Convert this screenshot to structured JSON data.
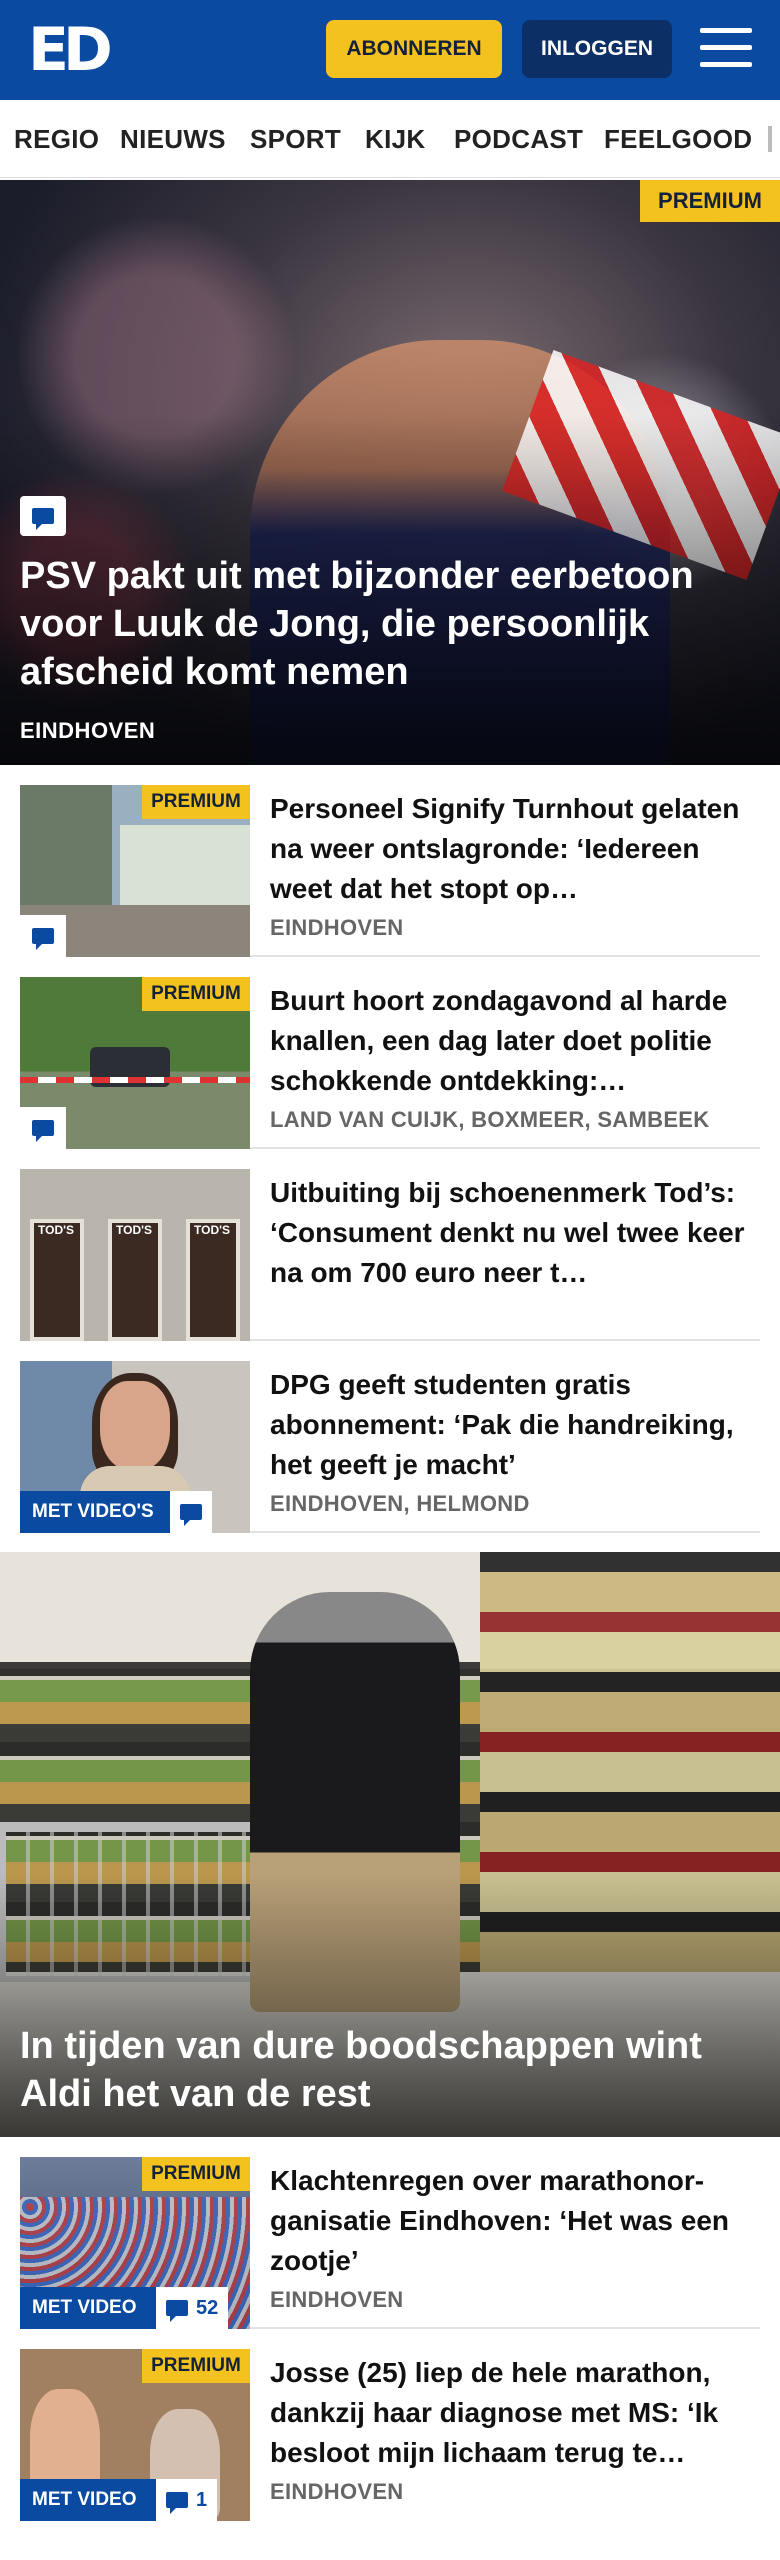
{
  "header": {
    "logo": "ED",
    "subscribe_label": "ABONNEREN",
    "login_label": "INLOGGEN",
    "menu_icon": "hamburger-menu-icon"
  },
  "nav": {
    "items": [
      "REGIO",
      "NIEUWS",
      "SPORT",
      "KIJK",
      "PODCAST",
      "FEELGOOD"
    ]
  },
  "hero": {
    "badge": "PREMIUM",
    "title": "PSV pakt uit met bijzonder eerbetoon voor Luuk de Jong, die persoonlijk afscheid komt nemen",
    "region": "EINDHOVEN",
    "comment_icon": "comment-icon"
  },
  "articles": [
    {
      "badge": "PREMIUM",
      "title": "Personeel Signify Turnhout gelaten na weer ontslagronde: ‘Iedereen weet dat het stopt op…",
      "region": "EINDHOVEN"
    },
    {
      "badge": "PREMIUM",
      "title": "Buurt hoort zondagavond al harde knallen, een dag later doet politie schokkende ontdekking:…",
      "region": "LAND VAN CUIJK, BOXMEER, SAMBEEK"
    },
    {
      "title": "Uitbuiting bij schoenenmerk Tod’s: ‘Consument denkt nu wel twee keer na om 700 euro neer t…",
      "thumb_signs": [
        "TOD'S",
        "TOD'S",
        "TOD'S"
      ]
    },
    {
      "video_label": "MET VIDEO'S",
      "title": "DPG geeft studenten gratis abonnement: ‘Pak die handrei­king, het geeft je macht’",
      "region": "EINDHOVEN, HELMOND"
    }
  ],
  "feature": {
    "title": "In tijden van dure boodschappen wint Aldi het van de rest"
  },
  "articles2": [
    {
      "badge": "PREMIUM",
      "video_label": "MET VIDEO",
      "comment_count": "52",
      "title": "Klachtenregen over marathonor­ganisatie Eindhoven: ‘Het was een zootje’",
      "region": "EINDHOVEN"
    },
    {
      "badge": "PREMIUM",
      "video_label": "MET VIDEO",
      "comment_count": "1",
      "title": "Josse (25) liep de hele marathon, dankzij haar diagnose met MS: ‘Ik besloot mijn lichaam terug te…",
      "region": "EINDHOVEN"
    }
  ],
  "colors": {
    "brand_blue": "#0a4aa0",
    "premium_yellow": "#f4c21f",
    "login_navy": "#0c2f66"
  }
}
